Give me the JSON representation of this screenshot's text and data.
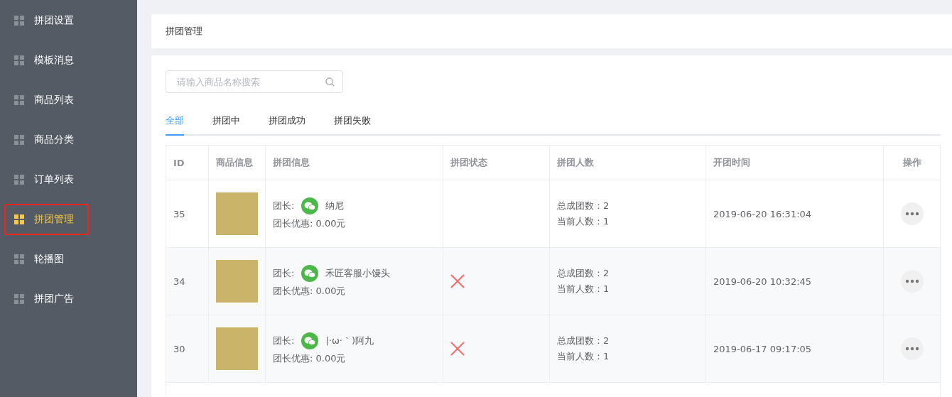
{
  "sidebar": {
    "items": [
      {
        "label": "拼团设置",
        "selected": false
      },
      {
        "label": "模板消息",
        "selected": false
      },
      {
        "label": "商品列表",
        "selected": false
      },
      {
        "label": "商品分类",
        "selected": false
      },
      {
        "label": "订单列表",
        "selected": false
      },
      {
        "label": "拼团管理",
        "selected": true
      },
      {
        "label": "轮播图",
        "selected": false
      },
      {
        "label": "拼团广告",
        "selected": false
      }
    ]
  },
  "header": {
    "title": "拼团管理"
  },
  "search": {
    "placeholder": "请输入商品名称搜索"
  },
  "tabs": [
    {
      "label": "全部",
      "selected": true
    },
    {
      "label": "拼团中",
      "selected": false
    },
    {
      "label": "拼团成功",
      "selected": false
    },
    {
      "label": "拼团失败",
      "selected": false
    }
  ],
  "table": {
    "columns": [
      "ID",
      "商品信息",
      "拼团信息",
      "拼团状态",
      "拼团人数",
      "开团时间",
      "操作"
    ],
    "rows": [
      {
        "id": "35",
        "leader_label": "团长:",
        "leader": "纳尼",
        "discount": "团长优惠: 0.00元",
        "failed": false,
        "total": "总成团数：2",
        "current": "当前人数：1",
        "time": "2019-06-20 16:31:04",
        "shaded": false
      },
      {
        "id": "34",
        "leader_label": "团长:",
        "leader": "禾匠客服小馒头",
        "discount": "团长优惠: 0.00元",
        "failed": true,
        "total": "总成团数：2",
        "current": "当前人数：1",
        "time": "2019-06-20 10:32:45",
        "shaded": true
      },
      {
        "id": "30",
        "leader_label": "团长:",
        "leader": "|·ω·｀)阿九",
        "discount": "团长优惠: 0.00元",
        "failed": true,
        "total": "总成团数：2",
        "current": "当前人数：1",
        "time": "2019-06-17 09:17:05",
        "shaded": true
      }
    ]
  }
}
